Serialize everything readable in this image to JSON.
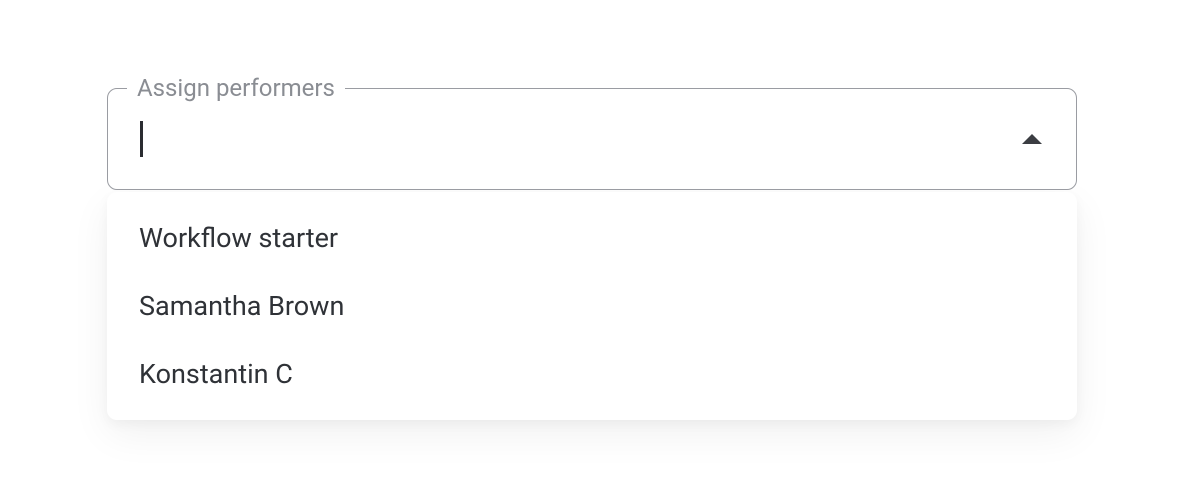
{
  "combobox": {
    "label": "Assign performers",
    "value": "",
    "options": [
      {
        "label": "Workflow starter"
      },
      {
        "label": "Samantha Brown"
      },
      {
        "label": "Konstantin C"
      }
    ]
  }
}
